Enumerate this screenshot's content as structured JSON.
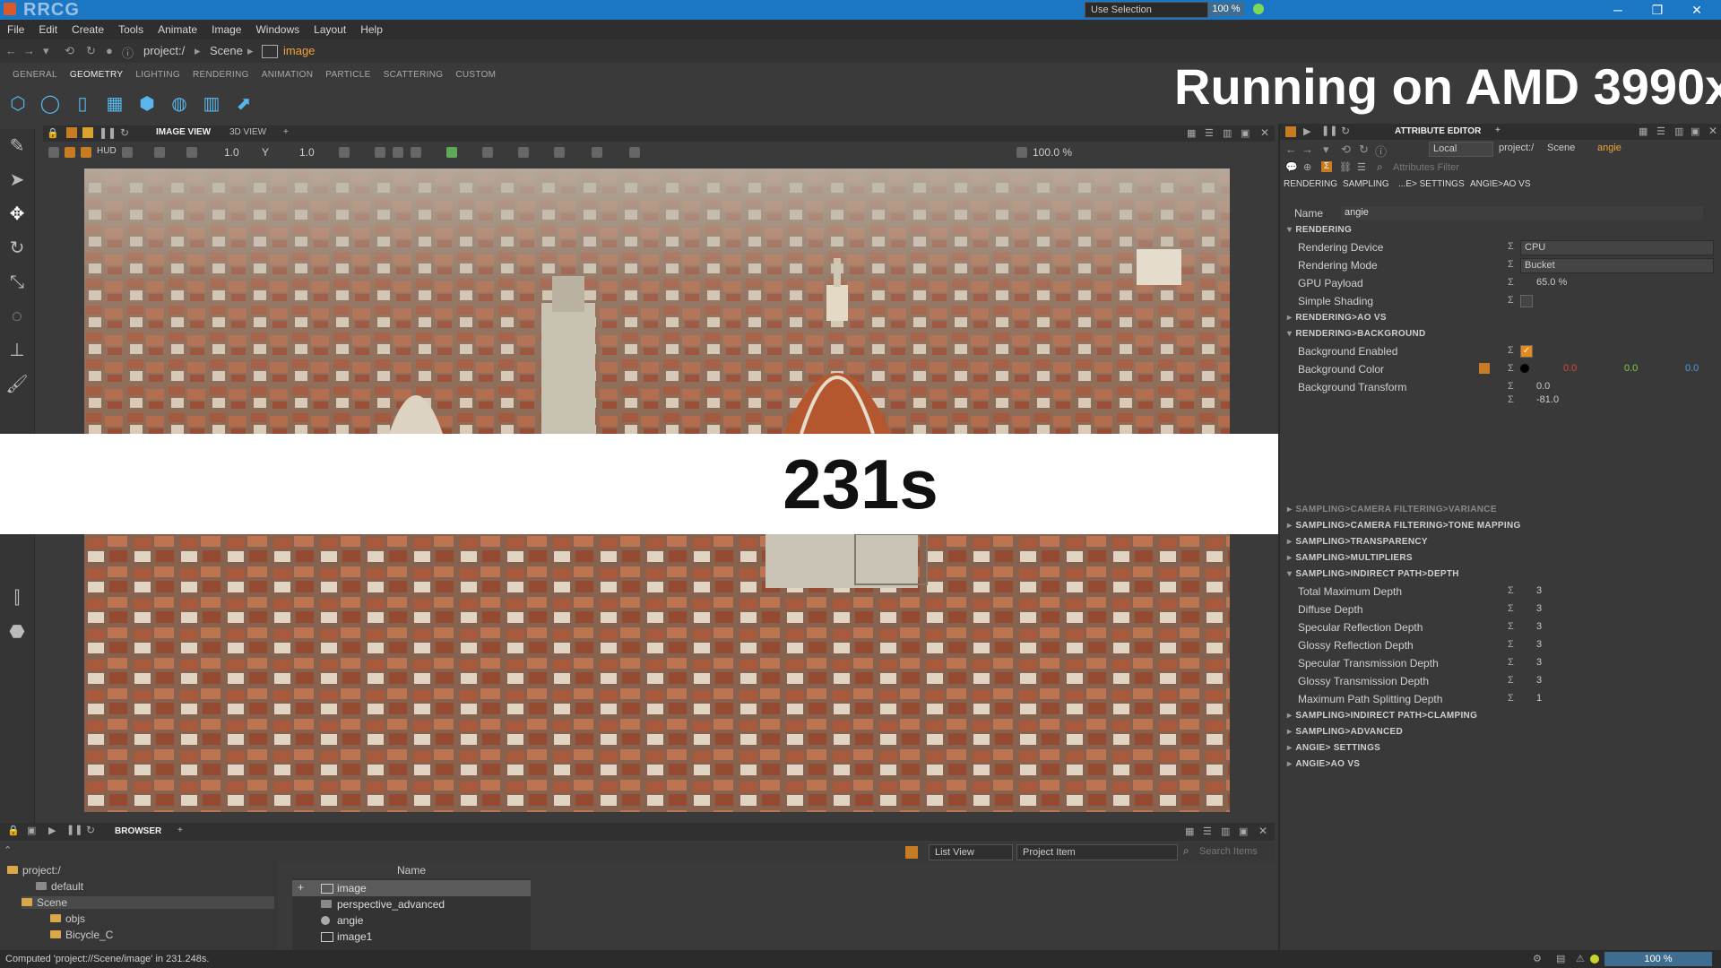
{
  "window": {
    "watermark": "RRCG",
    "minimize": "─",
    "restore": "❐",
    "close": "✕"
  },
  "menu": [
    "File",
    "Edit",
    "Create",
    "Tools",
    "Animate",
    "Image",
    "Windows",
    "Layout",
    "Help"
  ],
  "address": {
    "root": "project:/",
    "scene": "Scene",
    "item": "image"
  },
  "shelf_tabs": [
    "GENERAL",
    "GEOMETRY",
    "LIGHTING",
    "RENDERING",
    "ANIMATION",
    "PARTICLE",
    "SCATTERING",
    "CUSTOM"
  ],
  "overlay_title": "Running on AMD 3990x",
  "overlay_time": "231s",
  "viewport": {
    "tab_image": "IMAGE VIEW",
    "tab_3d": "3D VIEW",
    "add": "+",
    "hud": "HUD",
    "exposure": "1.0",
    "gamma_label": "Y",
    "gamma": "1.0",
    "zoom_pct": "100.0 %",
    "selection": "Use Selection",
    "zoom": "100 %"
  },
  "attr_editor": {
    "title": "ATTRIBUTE EDITOR",
    "add": "+",
    "space": "Local",
    "path_root": "project:/",
    "path_scene": "Scene",
    "path_item": "angie",
    "filter_placeholder": "Attributes Filter",
    "tabs": [
      "RENDERING",
      "SAMPLING",
      "...E> SETTINGS",
      "ANGIE>AO VS"
    ],
    "name_label": "Name",
    "name_value": "angie",
    "sec_rendering": "RENDERING",
    "rendering_device_label": "Rendering Device",
    "rendering_device": "CPU",
    "rendering_mode_label": "Rendering Mode",
    "rendering_mode": "Bucket",
    "gpu_payload_label": "GPU Payload",
    "gpu_payload": "65.0 %",
    "simple_shading_label": "Simple Shading",
    "sec_ao": "RENDERING>AO VS",
    "sec_bg": "RENDERING>BACKGROUND",
    "bg_enabled_label": "Background Enabled",
    "bg_color_label": "Background Color",
    "bg_r": "0.0",
    "bg_g": "0.0",
    "bg_b": "0.0",
    "bg_transform_label": "Background Transform",
    "bg_tx": "0.0",
    "bg_ty": "-81.0",
    "lower_sections": [
      "SAMPLING>CAMERA FILTERING>VARIANCE",
      "SAMPLING>CAMERA FILTERING>TONE MAPPING",
      "SAMPLING>TRANSPARENCY",
      "SAMPLING>MULTIPLIERS",
      "SAMPLING>INDIRECT PATH>DEPTH"
    ],
    "depth_rows": [
      {
        "label": "Total Maximum Depth",
        "value": "3"
      },
      {
        "label": "Diffuse Depth",
        "value": "3"
      },
      {
        "label": "Specular Reflection Depth",
        "value": "3"
      },
      {
        "label": "Glossy Reflection Depth",
        "value": "3"
      },
      {
        "label": "Specular Transmission Depth",
        "value": "3"
      },
      {
        "label": "Glossy Transmission Depth",
        "value": "3"
      },
      {
        "label": "Maximum Path Splitting Depth",
        "value": "1"
      }
    ],
    "tail_sections": [
      "SAMPLING>INDIRECT PATH>CLAMPING",
      "SAMPLING>ADVANCED",
      "ANGIE> SETTINGS",
      "ANGIE>AO VS"
    ]
  },
  "browser": {
    "title": "BROWSER",
    "add": "+",
    "view": "List View",
    "filter": "Project Item",
    "search_placeholder": "Search Items",
    "tree": [
      "project:/",
      "default",
      "Scene",
      "objs",
      "Bicycle_C"
    ],
    "col_name": "Name",
    "items": [
      "image",
      "perspective_advanced",
      "angie",
      "image1"
    ]
  },
  "status": {
    "message": "Computed 'project://Scene/image' in 231.248s.",
    "zoom": "100 %"
  },
  "colors": {
    "accent": "#1b76c4",
    "selection": "#3f6d90",
    "check": "#e8891a",
    "red": "#e0433f",
    "green": "#7cd04e",
    "blue": "#4a9ee8"
  }
}
